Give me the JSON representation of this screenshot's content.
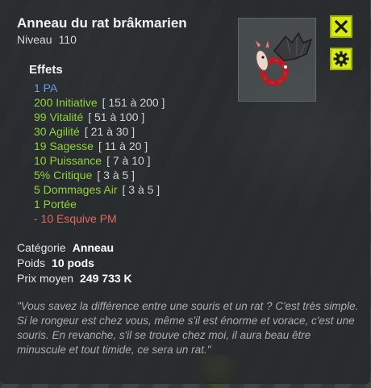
{
  "item": {
    "name": "Anneau du rat brâkmarien",
    "level_label": "Niveau",
    "level": "110"
  },
  "buttons": {
    "close_icon": "close-x-icon",
    "settings_icon": "gear-icon"
  },
  "effects": {
    "title": "Effets",
    "lines": [
      {
        "text": "1 PA",
        "range": "",
        "color": "blue"
      },
      {
        "text": "200 Initiative",
        "range": "[ 151 à 200 ]",
        "color": "green"
      },
      {
        "text": "99 Vitalité",
        "range": "[ 51 à 100 ]",
        "color": "green"
      },
      {
        "text": "30 Agilité",
        "range": "[ 21 à 30 ]",
        "color": "green"
      },
      {
        "text": "19 Sagesse",
        "range": "[ 11 à 20 ]",
        "color": "green"
      },
      {
        "text": "10 Puissance",
        "range": "[ 7 à 10 ]",
        "color": "green"
      },
      {
        "text": "5% Critique",
        "range": "[ 3 à 5 ]",
        "color": "green"
      },
      {
        "text": "5 Dommages Air",
        "range": "[ 3 à 5 ]",
        "color": "green"
      },
      {
        "text": "1 Portée",
        "range": "",
        "color": "green"
      },
      {
        "text": "- 10 Esquive PM",
        "range": "",
        "color": "red"
      }
    ]
  },
  "info": {
    "category_label": "Catégorie",
    "category_value": "Anneau",
    "weight_label": "Poids",
    "weight_value": "10 pods",
    "price_label": "Prix moyen",
    "price_value": "249 733 K"
  },
  "description": "\"Vous savez la différence entre une souris et un rat ? C'est très simple. Si le rongeur est chez vous, même s'il est énorme et vorace, c'est une souris. En revanche, s'il se trouve chez moi, il aura beau être minuscule et tout timide, ce sera un rat.\"",
  "colors": {
    "button_accent": "#d6ea14",
    "effect_blue": "#6a9fe0",
    "effect_green": "#8fd43a",
    "effect_red": "#e4675c"
  }
}
